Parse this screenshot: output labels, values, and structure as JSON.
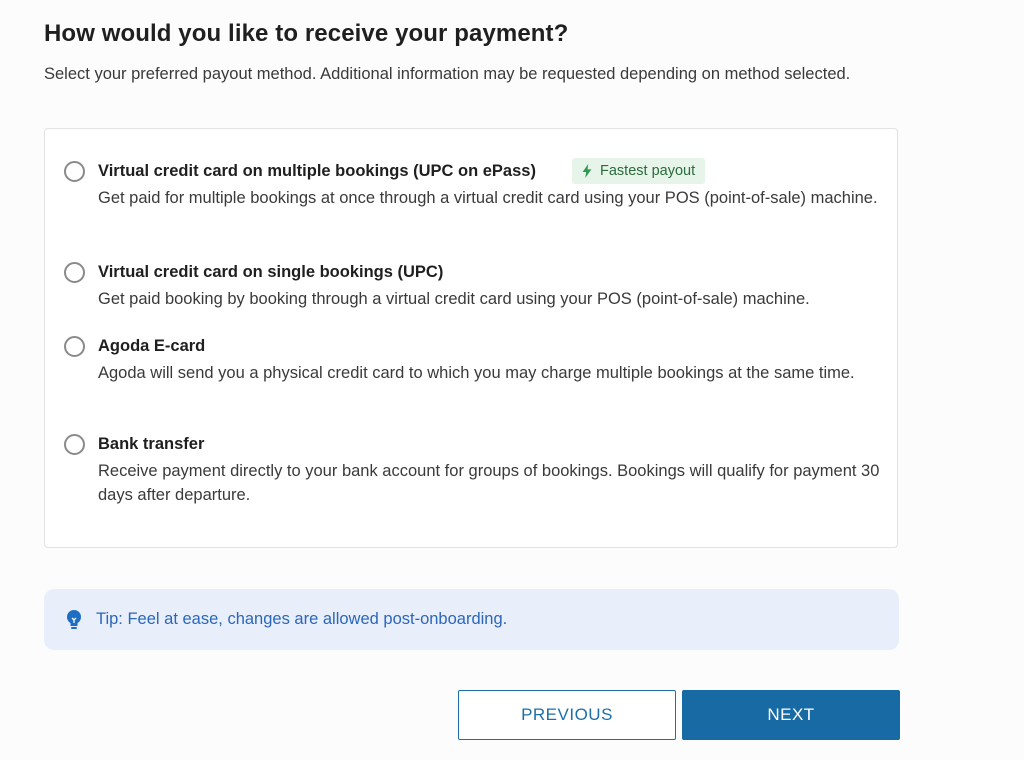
{
  "header": {
    "title": "How would you like to receive your payment?",
    "subtitle": "Select your preferred payout method. Additional information may be requested depending on method selected."
  },
  "options": [
    {
      "title": "Virtual credit card on multiple bookings (UPC on ePass)",
      "description": "Get paid for multiple bookings at once through a virtual credit card using your POS (point-of-sale) machine.",
      "badge": "Fastest payout",
      "selected": false
    },
    {
      "title": "Virtual credit card on single bookings (UPC)",
      "description": "Get paid booking by booking through a virtual credit card using your POS (point-of-sale) machine.",
      "selected": false
    },
    {
      "title": "Agoda E-card",
      "description": "Agoda will send you a physical credit card to which you may charge multiple bookings at the same time.",
      "selected": false
    },
    {
      "title": "Bank transfer",
      "description": "Receive payment directly to your bank account for groups of bookings. Bookings will qualify for payment 30 days after departure.",
      "selected": false
    }
  ],
  "tip": {
    "icon": "lightbulb-icon",
    "text": "Tip: Feel at ease, changes are allowed post-onboarding."
  },
  "buttons": {
    "previous_label": "PREVIOUS",
    "next_label": "NEXT"
  },
  "colors": {
    "primary": "#176aa3",
    "badge_bg": "#e6f4ea",
    "badge_text": "#2b6b3c",
    "tip_bg": "#e9eefb",
    "tip_text": "#2a67b8"
  }
}
